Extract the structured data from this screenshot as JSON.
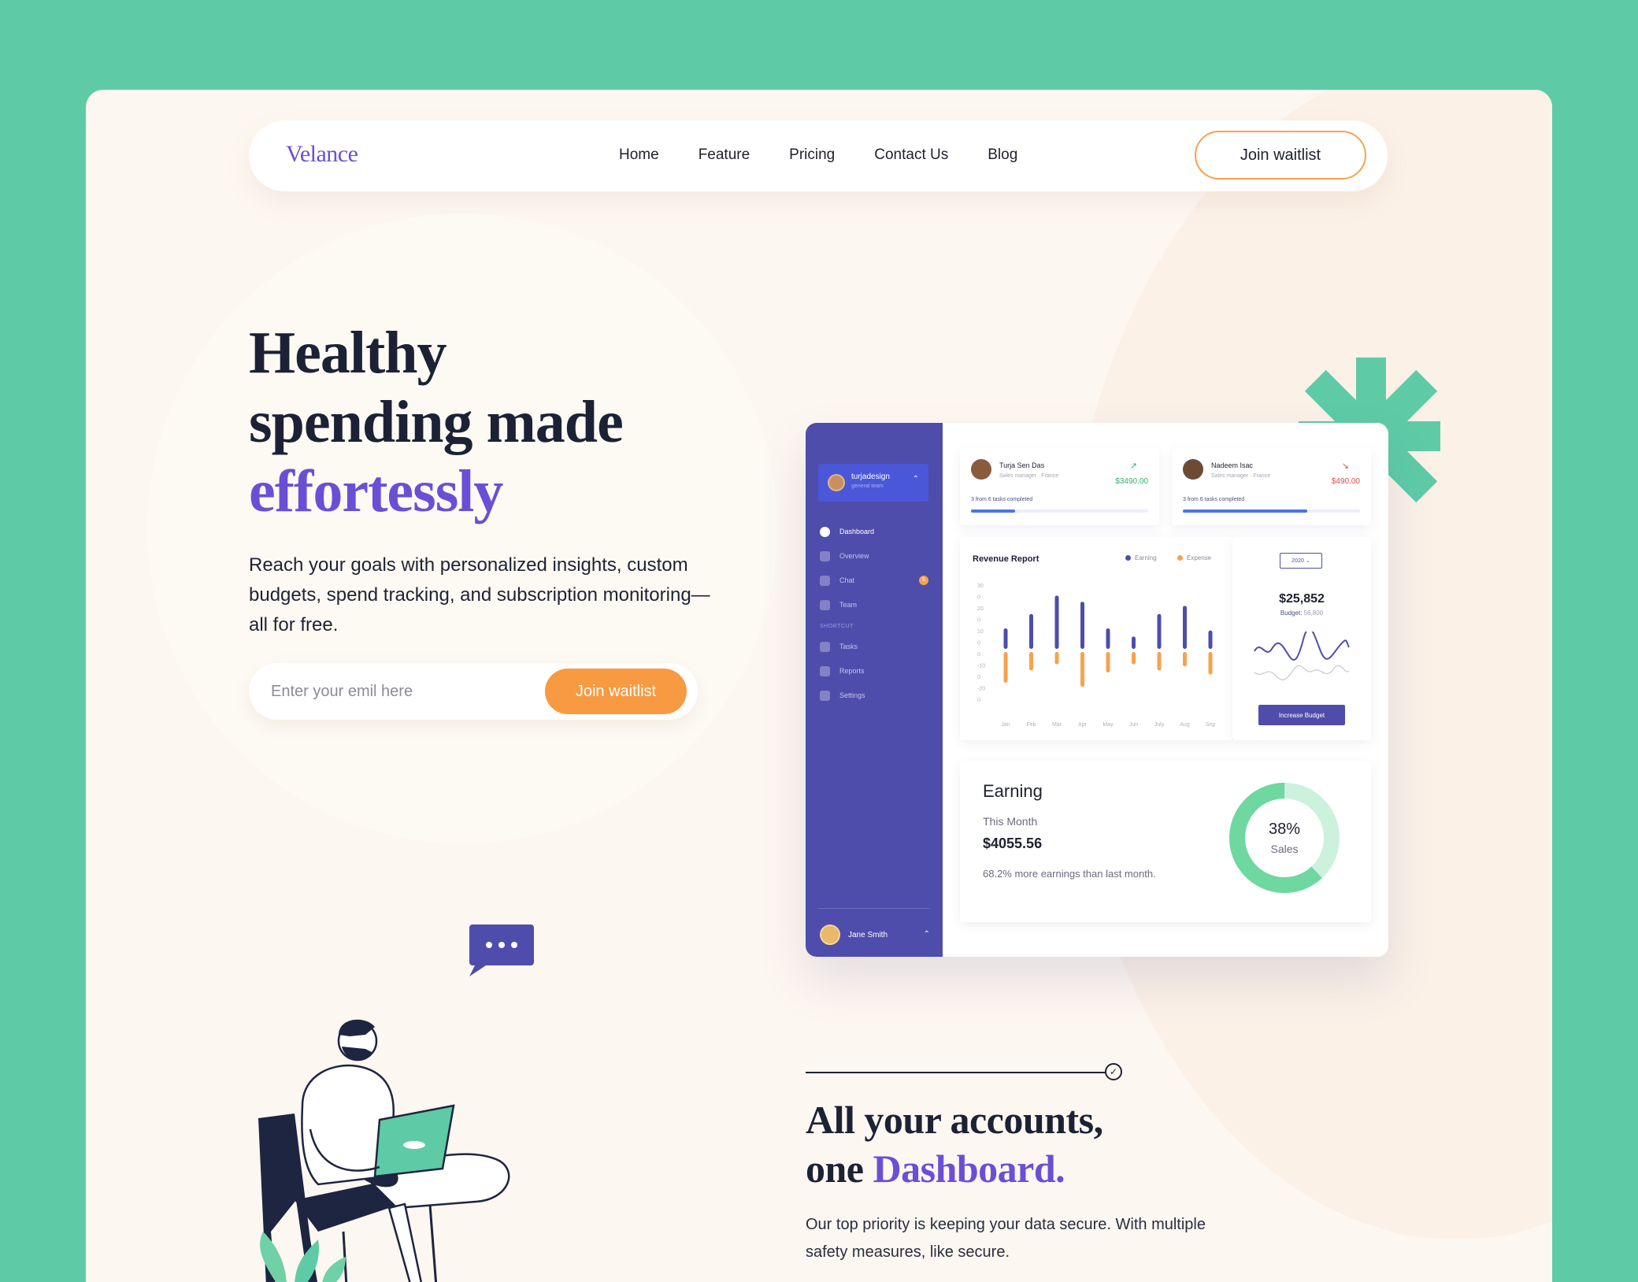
{
  "nav": {
    "logo": "Velance",
    "links": [
      "Home",
      "Feature",
      "Pricing",
      "Contact Us",
      "Blog"
    ],
    "cta": "Join waitlist"
  },
  "hero": {
    "title_line1": "Healthy",
    "title_line2": "spending made",
    "title_accent": "effortessly",
    "subtitle": "Reach your goals with personalized insights, custom budgets, spend tracking, and subscription monitoring—all for free.",
    "email_placeholder": "Enter your emil here",
    "email_button": "Join waitlist"
  },
  "dashboard": {
    "workspace": {
      "name": "turjadesign",
      "subtitle": "general team"
    },
    "menu": [
      "Dashboard",
      "Overview",
      "Chat",
      "Team"
    ],
    "chat_badge": "5",
    "shortcut_label": "SHORTCUT",
    "shortcuts": [
      "Tasks",
      "Reports",
      "Settings"
    ],
    "footer_user": "Jane Smith",
    "users": [
      {
        "name": "Turja Sen Das",
        "role": "Sales manager · France",
        "amount": "$3490.00",
        "trend": "up",
        "progress_text": "3 from 6 tasks completed",
        "progress": 0.25
      },
      {
        "name": "Nadeem Isac",
        "role": "Sales manager · France",
        "amount": "$490.00",
        "trend": "down",
        "progress_text": "3 from 6 tasks completed",
        "progress": 0.7
      }
    ],
    "revenue": {
      "title": "Revenue Report",
      "legend_earning": "Earning",
      "legend_expense": "Expense"
    },
    "budget": {
      "year": "2020",
      "amount": "$25,852",
      "budget_label": "Budget:",
      "budget_value": "56,800",
      "button": "Increase Budget"
    },
    "earning": {
      "title": "Earning",
      "period": "This Month",
      "amount": "$4055.56",
      "note": "68.2% more earnings than last month.",
      "percent": "38%",
      "percent_label": "Sales"
    }
  },
  "chart_data": {
    "type": "bar",
    "title": "Revenue Report",
    "categories": [
      "Jan",
      "Feb",
      "Mar",
      "Apr",
      "May",
      "Jun",
      "July",
      "Aug",
      "Sep"
    ],
    "series": [
      {
        "name": "Earning",
        "values": [
          10,
          17,
          26,
          23,
          10,
          6,
          17,
          21,
          9
        ]
      },
      {
        "name": "Expense",
        "values": [
          -15,
          -9,
          -6,
          -17,
          -10,
          -6,
          -9,
          -7,
          -11
        ]
      }
    ],
    "yticks": [
      "30",
      "0",
      "20",
      "0",
      "10",
      "0",
      "0",
      "-10",
      "0",
      "-20",
      "0"
    ],
    "colors": {
      "Earning": "#4e4dab",
      "Expense": "#f7a24d"
    }
  },
  "section": {
    "title_line1": "All your accounts,",
    "title_line2_prefix": "one ",
    "title_accent": "Dashboard.",
    "description": "Our top priority is keeping your data secure. With multiple safety measures, like secure."
  },
  "colors": {
    "background": "#5ecba6",
    "page": "#fdf7f1",
    "accent_purple": "#6a4fd6",
    "accent_orange": "#f79a42",
    "dashboard_sidebar": "#4e4dab",
    "donut_green": "#5ccf96"
  },
  "icons": [
    "asterisk-decoration",
    "chat-bubble-icon",
    "trend-up-icon",
    "trend-down-icon",
    "chevron-icon",
    "check-icon"
  ]
}
